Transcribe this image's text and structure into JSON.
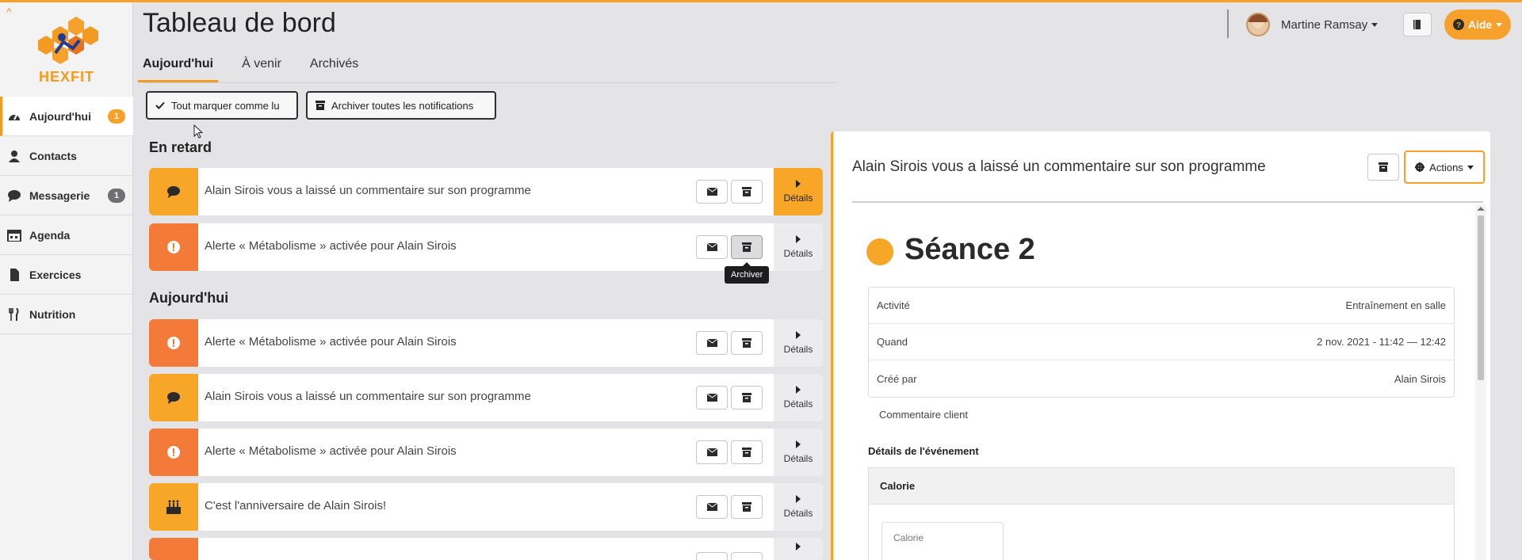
{
  "colors": {
    "accent": "#f6a12c",
    "alert": "#f37a38",
    "dark": "#2e2e30"
  },
  "sidebar": {
    "logo_text": "HEXFIT",
    "items": [
      {
        "label": "Aujourd'hui",
        "icon": "dashboard-icon",
        "badge": "1",
        "active": true
      },
      {
        "label": "Contacts",
        "icon": "user-icon"
      },
      {
        "label": "Messagerie",
        "icon": "comment-icon",
        "badge": "1"
      },
      {
        "label": "Agenda",
        "icon": "calendar-icon"
      },
      {
        "label": "Exercices",
        "icon": "file-icon"
      },
      {
        "label": "Nutrition",
        "icon": "utensils-icon"
      }
    ]
  },
  "header": {
    "title": "Tableau de bord",
    "tabs": [
      "Aujourd'hui",
      "À venir",
      "Archivés"
    ],
    "user_name": "Martine Ramsay",
    "help_label": "Aide"
  },
  "toolbar": {
    "mark_all_read": "Tout marquer comme lu",
    "archive_all": "Archiver toutes les notifications"
  },
  "sections": {
    "late": "En retard",
    "today": "Aujourd'hui"
  },
  "notifications": {
    "late": [
      {
        "text": "Alain Sirois vous a laissé un commentaire sur son programme",
        "icon": "comment-icon",
        "details": "Détails"
      },
      {
        "text": "Alerte « Métabolisme » activée pour Alain Sirois",
        "icon": "exclamation-icon",
        "details": "Détails"
      }
    ],
    "today": [
      {
        "text": "Alerte « Métabolisme » activée pour Alain Sirois",
        "icon": "exclamation-icon",
        "details": "Détails"
      },
      {
        "text": "Alain Sirois vous a laissé un commentaire sur son programme",
        "icon": "comment-icon",
        "details": "Détails"
      },
      {
        "text": "Alerte « Métabolisme » activée pour Alain Sirois",
        "icon": "exclamation-icon",
        "details": "Détails"
      },
      {
        "text": "C'est l'anniversaire de Alain Sirois!",
        "icon": "birthday-cake-icon",
        "details": "Détails"
      }
    ]
  },
  "tooltip": "Archiver",
  "panel": {
    "title": "Alain Sirois vous a laissé un commentaire sur son programme",
    "actions_label": "Actions",
    "seance_title": "Séance 2",
    "rows": [
      {
        "label": "Activité",
        "value": "Entraînement en salle"
      },
      {
        "label": "Quand",
        "value": "2 nov. 2021 - 11:42 — 12:42"
      },
      {
        "label": "Créé par",
        "value": "Alain Sirois"
      }
    ],
    "comment_label": "Commentaire client",
    "event_details_label": "Détails de l'événement",
    "calorie_header": "Calorie",
    "calorie_card_label": "Calorie"
  }
}
